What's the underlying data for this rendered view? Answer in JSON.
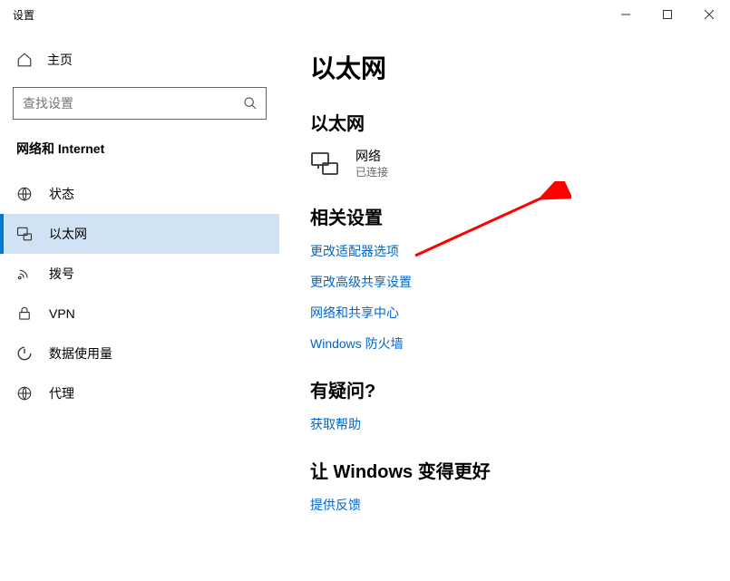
{
  "window": {
    "title": "设置"
  },
  "sidebar": {
    "home_label": "主页",
    "search_placeholder": "查找设置",
    "category": "网络和 Internet",
    "items": [
      {
        "label": "状态"
      },
      {
        "label": "以太网"
      },
      {
        "label": "拨号"
      },
      {
        "label": "VPN"
      },
      {
        "label": "数据使用量"
      },
      {
        "label": "代理"
      }
    ]
  },
  "main": {
    "page_title": "以太网",
    "section_ethernet": "以太网",
    "network": {
      "name": "网络",
      "status": "已连接"
    },
    "section_related": "相关设置",
    "links": {
      "adapter": "更改适配器选项",
      "sharing": "更改高级共享设置",
      "center": "网络和共享中心",
      "firewall": "Windows 防火墙"
    },
    "section_question": "有疑问?",
    "link_help": "获取帮助",
    "section_improve": "让 Windows 变得更好",
    "link_feedback": "提供反馈"
  }
}
